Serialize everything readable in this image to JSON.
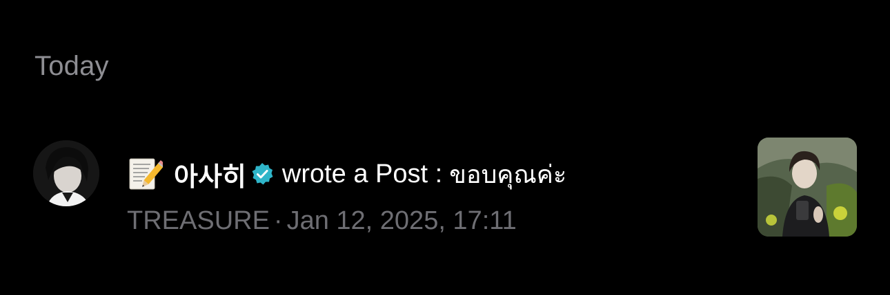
{
  "section": {
    "title": "Today"
  },
  "notification": {
    "memo_icon": "memo-pencil-icon",
    "author": "아사히",
    "verified_icon": "verified-badge-icon",
    "verified_color": "#2fb5c9",
    "action": "wrote a Post :",
    "preview": "ขอบคุณค่ะ",
    "group": "TREASURE",
    "separator": "·",
    "timestamp": "Jan 12, 2025, 17:11"
  }
}
